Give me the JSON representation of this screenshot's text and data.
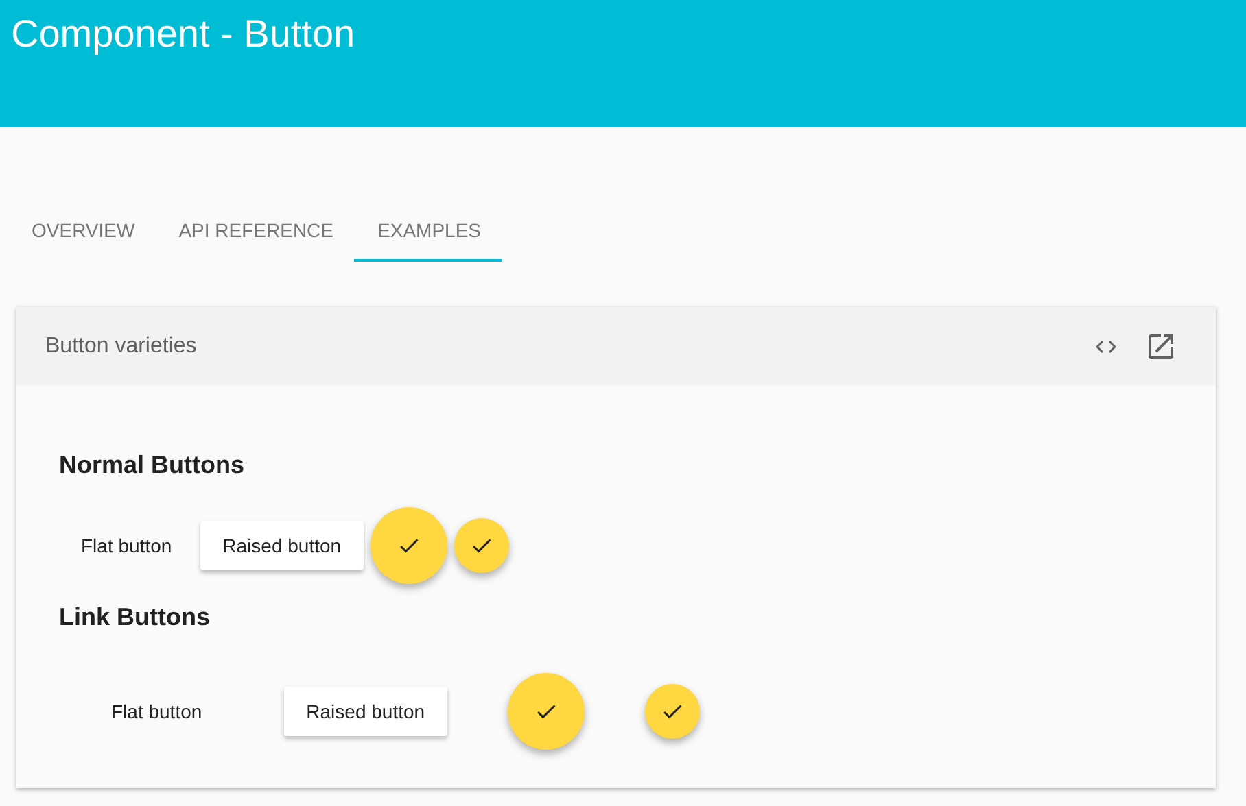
{
  "header": {
    "title": "Component - Button"
  },
  "tabs": [
    {
      "label": "OVERVIEW",
      "selected": false
    },
    {
      "label": "API REFERENCE",
      "selected": false
    },
    {
      "label": "EXAMPLES",
      "selected": true
    }
  ],
  "card": {
    "title": "Button varieties",
    "sections": [
      {
        "kind": "normal",
        "title": "Normal Buttons",
        "buttons": [
          {
            "kind": "flat",
            "label": "Flat button"
          },
          {
            "kind": "raised",
            "label": "Raised button"
          },
          {
            "kind": "fab"
          },
          {
            "kind": "mini-fab"
          }
        ]
      },
      {
        "kind": "link",
        "title": "Link Buttons",
        "buttons": [
          {
            "kind": "flat",
            "label": "Flat button"
          },
          {
            "kind": "raised",
            "label": "Raised button"
          },
          {
            "kind": "fab"
          },
          {
            "kind": "mini-fab"
          }
        ]
      }
    ]
  }
}
